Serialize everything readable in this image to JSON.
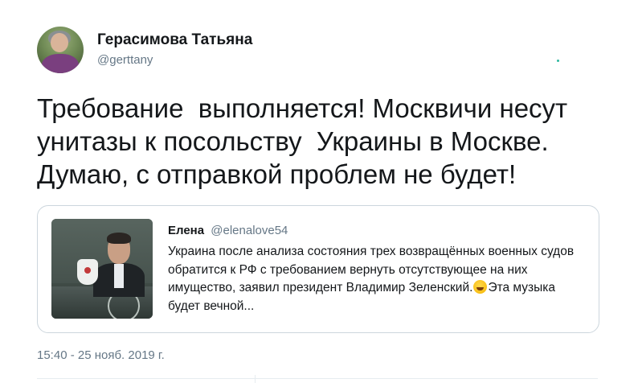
{
  "tweet": {
    "author_name": "Герасимова Татьяна",
    "author_handle": "@gerttany",
    "text": "Требование  выполняется! Москвичи несут унитазы к посольству  Украины в Москве. Думаю, с отправкой проблем не будет!",
    "timestamp": "15:40 - 25 нояб. 2019 г."
  },
  "quote": {
    "author_name": "Елена",
    "author_handle": "@elenalove54",
    "text_before_emoji": "Украина после анализа состояния трех возвращённых военных судов обратится к РФ с требованием вернуть отсутствующее на них имущество, заявил президент Владимир Зеленский.",
    "emoji_icon": "rolling-on-floor-laughing-emoji",
    "text_after_emoji": "Эта музыка будет вечной..."
  },
  "colors": {
    "text_primary": "#14171a",
    "text_secondary": "#657786",
    "border": "#ccd6dd"
  }
}
